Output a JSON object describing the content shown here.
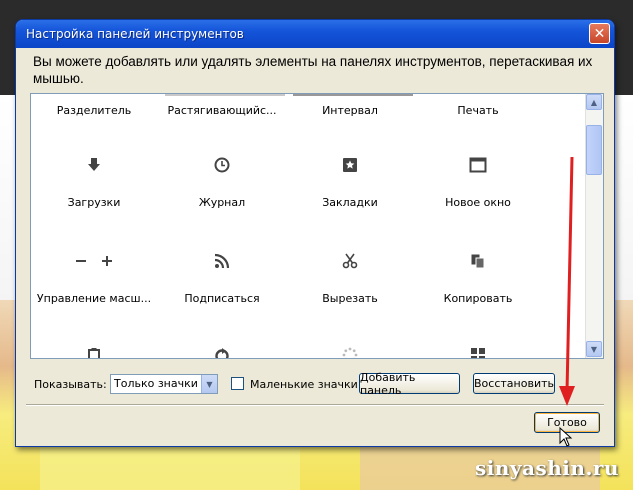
{
  "window": {
    "title": "Настройка панелей инструментов",
    "instruction": "Вы можете добавлять или удалять элементы на панелях инструментов, перетаскивая их мышью."
  },
  "items": [
    {
      "label": "Разделитель",
      "icon": "separator-icon"
    },
    {
      "label": "Растягивающийс...",
      "icon": "spacer-icon"
    },
    {
      "label": "Интервал",
      "icon": "space-icon"
    },
    {
      "label": "Печать",
      "icon": "print-icon"
    },
    {
      "label": "Загрузки",
      "icon": "download-arrow-icon"
    },
    {
      "label": "Журнал",
      "icon": "history-clock-icon"
    },
    {
      "label": "Закладки",
      "icon": "bookmarks-star-icon"
    },
    {
      "label": "Новое окно",
      "icon": "new-window-icon"
    },
    {
      "label": "Управление масш...",
      "icon": "zoom-minus-plus-icon"
    },
    {
      "label": "Подписаться",
      "icon": "rss-feed-icon"
    },
    {
      "label": "Вырезать",
      "icon": "scissors-icon"
    },
    {
      "label": "Копировать",
      "icon": "copy-icon"
    },
    {
      "label": "",
      "icon": "paste-clipboard-icon"
    },
    {
      "label": "",
      "icon": "reload-icon"
    },
    {
      "label": "",
      "icon": "throbber-icon"
    },
    {
      "label": "",
      "icon": "grid-icon"
    }
  ],
  "controls": {
    "show_label": "Показывать:",
    "show_value": "Только значки",
    "small_icons_label": "Маленькие значки",
    "small_icons_checked": false,
    "add_panel": "Добавить панель",
    "restore": "Восстановить",
    "done": "Готово"
  },
  "watermark": "sinyashin.ru",
  "colors": {
    "titlebar": "#0b45c8",
    "dialog_bg": "#ece9d8",
    "annotation_arrow": "#e02020"
  }
}
